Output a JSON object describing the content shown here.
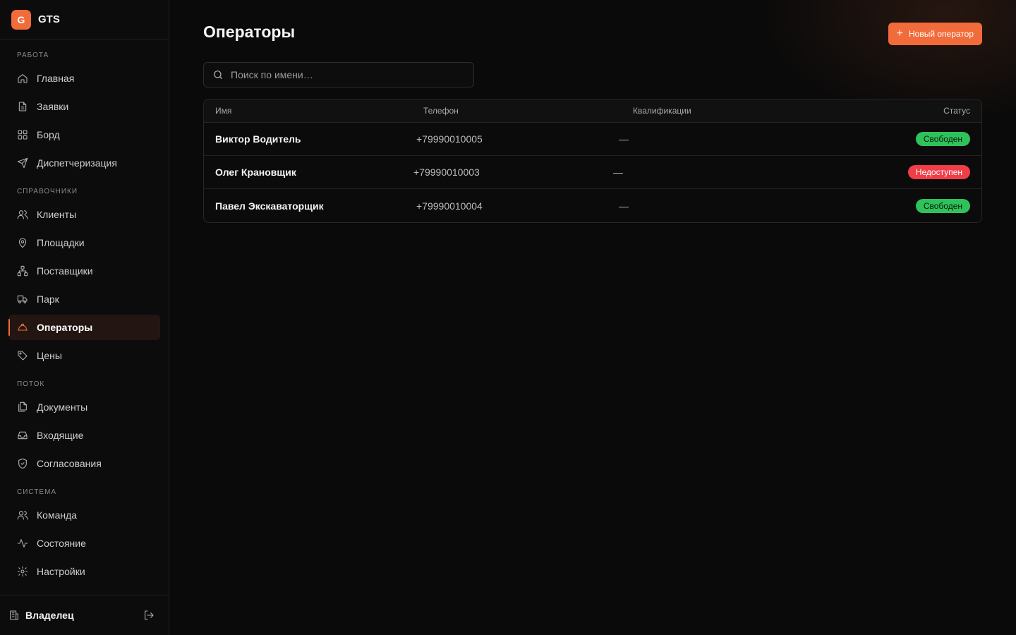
{
  "brand": {
    "logo_letter": "G",
    "name": "GTS",
    "accent": "#f26b3a"
  },
  "sidebar": {
    "sections": [
      {
        "label": "РАБОТА",
        "items": [
          {
            "label": "Главная",
            "icon": "home-icon"
          },
          {
            "label": "Заявки",
            "icon": "file-text-icon"
          },
          {
            "label": "Борд",
            "icon": "grid-icon"
          },
          {
            "label": "Диспетчеризация",
            "icon": "send-icon"
          }
        ]
      },
      {
        "label": "СПРАВОЧНИКИ",
        "items": [
          {
            "label": "Клиенты",
            "icon": "users-icon"
          },
          {
            "label": "Площадки",
            "icon": "map-pin-icon"
          },
          {
            "label": "Поставщики",
            "icon": "network-icon"
          },
          {
            "label": "Парк",
            "icon": "truck-icon"
          },
          {
            "label": "Операторы",
            "icon": "hard-hat-icon",
            "active": true
          },
          {
            "label": "Цены",
            "icon": "tag-icon"
          }
        ]
      },
      {
        "label": "ПОТОК",
        "items": [
          {
            "label": "Документы",
            "icon": "files-icon"
          },
          {
            "label": "Входящие",
            "icon": "inbox-icon"
          },
          {
            "label": "Согласования",
            "icon": "shield-check-icon"
          }
        ]
      },
      {
        "label": "СИСТЕМА",
        "items": [
          {
            "label": "Команда",
            "icon": "team-icon"
          },
          {
            "label": "Состояние",
            "icon": "activity-icon"
          },
          {
            "label": "Настройки",
            "icon": "gear-icon"
          }
        ]
      }
    ],
    "footer": {
      "owner": "Владелец",
      "owner_icon": "building-icon",
      "logout_icon": "logout-icon"
    }
  },
  "main": {
    "title": "Операторы",
    "new_button": "Новый оператор",
    "search": {
      "placeholder": "Поиск по имени…",
      "value": ""
    },
    "table": {
      "columns": [
        "Имя",
        "Телефон",
        "Квалификации",
        "Статус"
      ],
      "rows": [
        {
          "name": "Виктор Водитель",
          "phone": "+79990010005",
          "qualifications": "—",
          "status": "Свободен",
          "status_color": "#2fc25b"
        },
        {
          "name": "Олег Крановщик",
          "phone": "+79990010003",
          "qualifications": "—",
          "status": "Недоступен",
          "status_color": "#ef3e47"
        },
        {
          "name": "Павел Экскаваторщик",
          "phone": "+79990010004",
          "qualifications": "—",
          "status": "Свободен",
          "status_color": "#2fc25b"
        }
      ]
    }
  }
}
